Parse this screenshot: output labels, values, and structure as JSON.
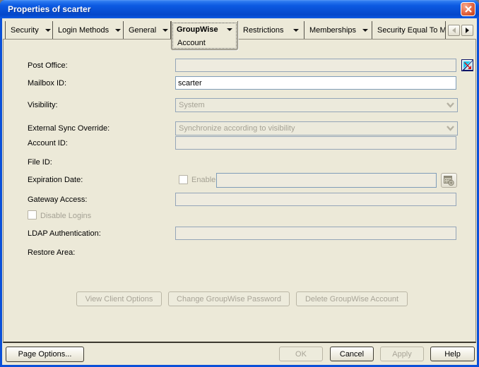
{
  "window": {
    "title": "Properties of scarter"
  },
  "tabs": {
    "items": [
      {
        "label": "Security"
      },
      {
        "label": "Login Methods"
      },
      {
        "label": "General"
      },
      {
        "label": "GroupWise",
        "sub_label": "Account",
        "active": true
      },
      {
        "label": "Restrictions"
      },
      {
        "label": "Memberships"
      },
      {
        "label": "Security Equal To Me"
      }
    ]
  },
  "form": {
    "post_office": {
      "label": "Post Office:",
      "value": ""
    },
    "mailbox_id": {
      "label": "Mailbox ID:",
      "value": "scarter"
    },
    "visibility": {
      "label": "Visibility:",
      "value": "System"
    },
    "external_sync_override": {
      "label": "External Sync Override:",
      "value": "Synchronize according to visibility"
    },
    "account_id": {
      "label": "Account ID:",
      "value": ""
    },
    "file_id": {
      "label": "File ID:"
    },
    "expiration_date": {
      "label": "Expiration Date:",
      "enable_label": "Enable",
      "value": "",
      "enabled": false
    },
    "gateway_access": {
      "label": "Gateway Access:",
      "value": ""
    },
    "disable_logins": {
      "label": "Disable Logins",
      "checked": false
    },
    "ldap_authentication": {
      "label": "LDAP Authentication:",
      "value": ""
    },
    "restore_area": {
      "label": "Restore Area:"
    }
  },
  "actions": {
    "view_client_options": "View Client Options",
    "change_groupwise_password": "Change GroupWise Password",
    "delete_groupwise_account": "Delete GroupWise Account"
  },
  "footer": {
    "page_options": "Page Options...",
    "ok": "OK",
    "cancel": "Cancel",
    "apply": "Apply",
    "help": "Help"
  },
  "colors": {
    "titlebar_blue": "#0a55dd",
    "dialog_bg": "#ece9d8",
    "input_border": "#7f9db9",
    "disabled_text": "#a5a295",
    "close_red": "#c03a10"
  }
}
